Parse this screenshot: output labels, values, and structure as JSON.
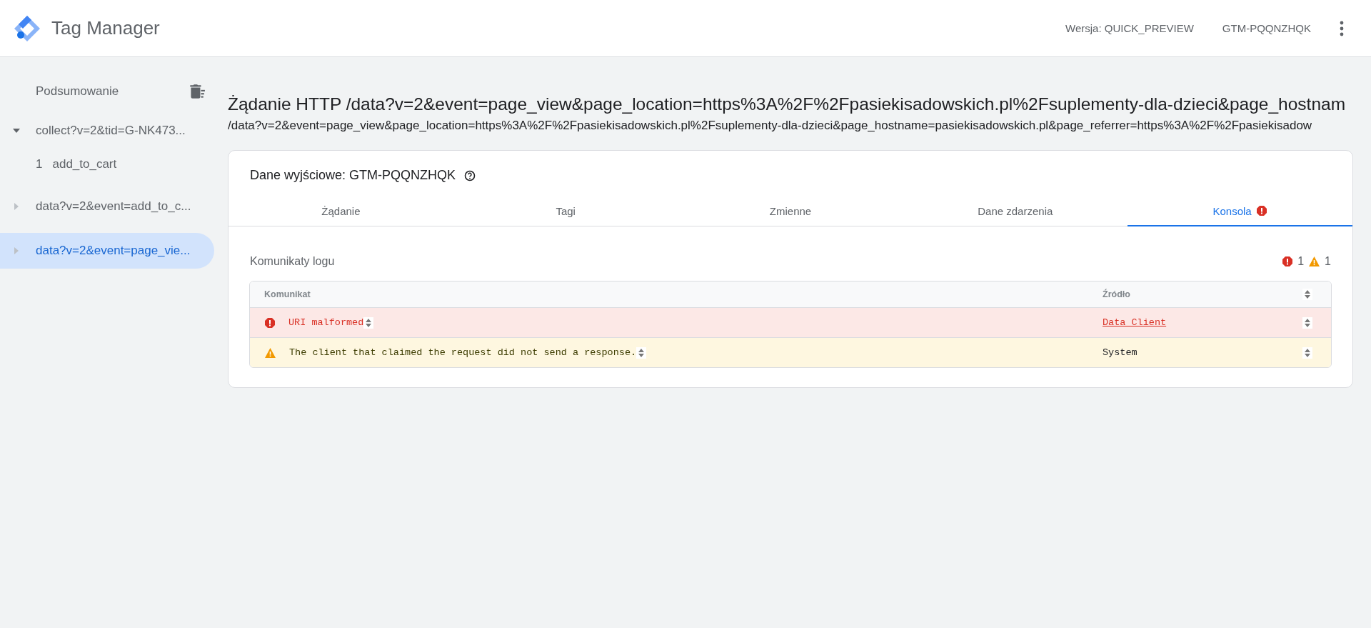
{
  "header": {
    "product": "Tag Manager",
    "version": "Wersja: QUICK_PREVIEW",
    "container": "GTM-PQQNZHQK"
  },
  "sidebar": {
    "summary": "Podsumowanie",
    "items": [
      {
        "label": "collect?v=2&tid=G-NK473...",
        "expanded": true,
        "selected": false,
        "children": [
          {
            "number": "1",
            "label": "add_to_cart"
          }
        ]
      },
      {
        "label": "data?v=2&event=add_to_c...",
        "expanded": false,
        "selected": false
      },
      {
        "label": "data?v=2&event=page_vie...",
        "expanded": false,
        "selected": true
      }
    ]
  },
  "request": {
    "title": "Żądanie HTTP /data?v=2&event=page_view&page_location=https%3A%2F%2Fpasiekisadowskich.pl%2Fsuplementy-dla-dzieci&page_hostnam",
    "url": "/data?v=2&event=page_view&page_location=https%3A%2F%2Fpasiekisadowskich.pl%2Fsuplementy-dla-dzieci&page_hostname=pasiekisadowskich.pl&page_referrer=https%3A%2F%2Fpasiekisadow"
  },
  "output": {
    "title": "Dane wyjściowe: GTM-PQQNZHQK",
    "tabs": [
      {
        "label": "Żądanie",
        "selected": false,
        "error": false
      },
      {
        "label": "Tagi",
        "selected": false,
        "error": false
      },
      {
        "label": "Zmienne",
        "selected": false,
        "error": false
      },
      {
        "label": "Dane zdarzenia",
        "selected": false,
        "error": false
      },
      {
        "label": "Konsola",
        "selected": true,
        "error": true
      }
    ],
    "log": {
      "title": "Komunikaty logu",
      "error_count": "1",
      "warning_count": "1",
      "columns": [
        "Komunikat",
        "Źródło"
      ],
      "rows": [
        {
          "kind": "error",
          "message": "URI malformed",
          "source": "Data Client",
          "source_link": true
        },
        {
          "kind": "warning",
          "message": "The client that claimed the request did not send a response.",
          "source": "System",
          "source_link": false
        }
      ]
    }
  }
}
